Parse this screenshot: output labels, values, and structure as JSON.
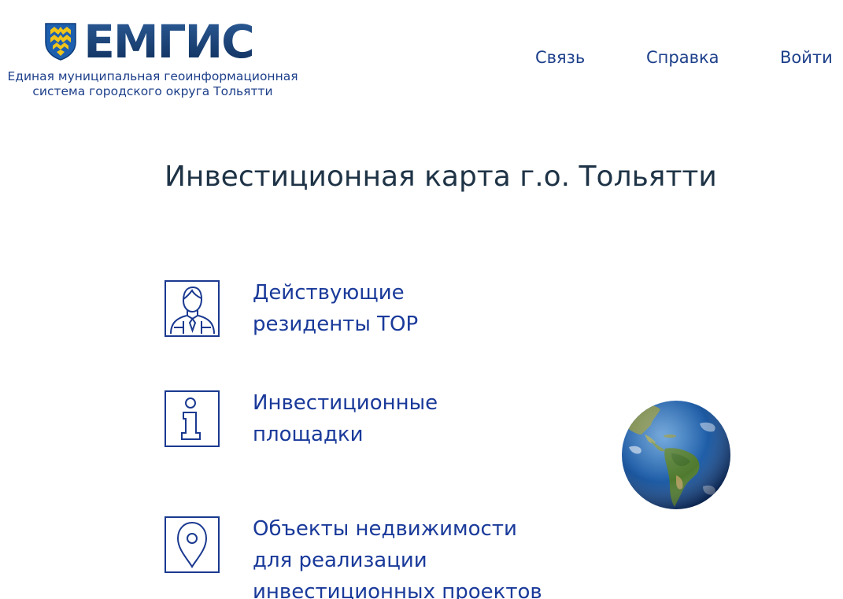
{
  "header": {
    "logo_title": "ЕМГИС",
    "logo_subtitle_line1": "Единая муниципальная геоинформационная",
    "logo_subtitle_line2": "система городского округа Тольятти",
    "logo_icon": "city-coat-of-arms-icon"
  },
  "nav": {
    "contact": "Связь",
    "help": "Справка",
    "login": "Войти"
  },
  "main": {
    "title": "Инвестиционная карта г.о. Тольятти",
    "items": [
      {
        "icon": "person-icon",
        "label_line1": "Действующие",
        "label_line2": "резиденты ТОР"
      },
      {
        "icon": "info-icon",
        "label_line1": "Инвестиционные",
        "label_line2": "площадки"
      },
      {
        "icon": "map-pin-icon",
        "label_line1": "Объекты недвижимости",
        "label_line2": "для реализации",
        "label_line3": "инвестиционных проектов"
      }
    ],
    "decoration_icon": "globe-icon"
  },
  "colors": {
    "brand_dark_blue": "#1b4a86",
    "link_blue": "#1d3f8a",
    "item_blue": "#1a3a9a",
    "title_text": "#1e3346",
    "emblem_gold": "#f0c419"
  }
}
